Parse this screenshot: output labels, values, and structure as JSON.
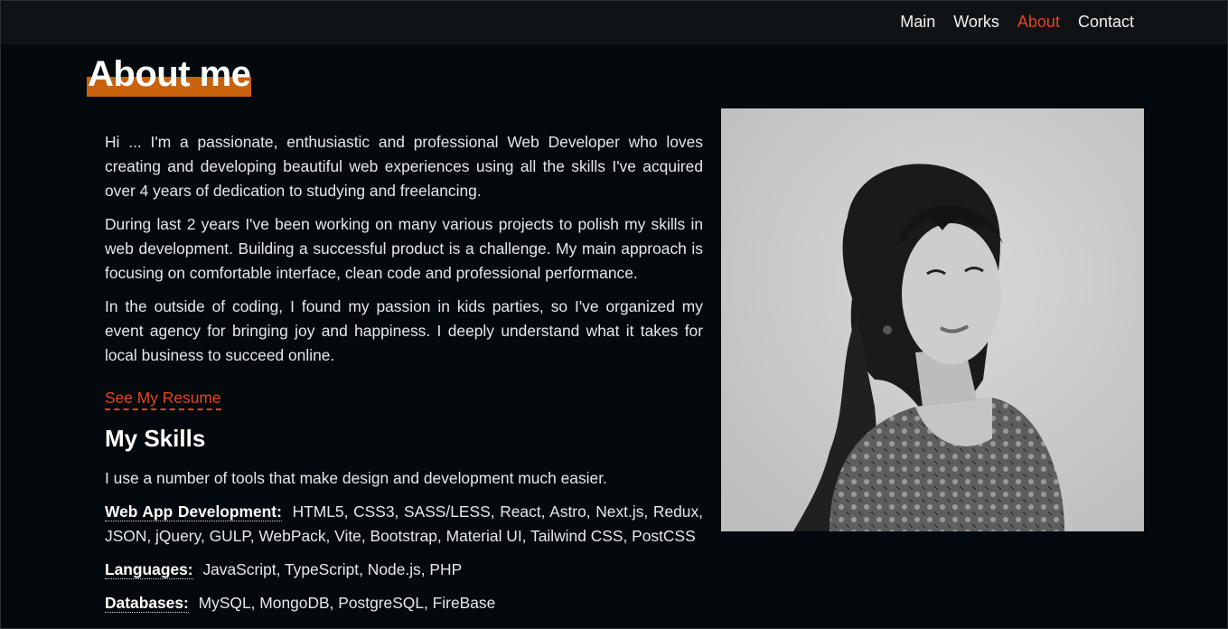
{
  "nav": {
    "items": [
      {
        "label": "Main",
        "active": false
      },
      {
        "label": "Works",
        "active": false
      },
      {
        "label": "About",
        "active": true
      },
      {
        "label": "Contact",
        "active": false
      }
    ]
  },
  "about": {
    "title": "About me",
    "paragraphs": [
      "Hi ... I'm a passionate, enthusiastic and professional Web Developer who loves creating and developing beautiful web experiences using all the skills I've acquired over 4 years of dedication to studying and freelancing.",
      "During last 2 years I've been working on many various projects to polish my skills in web development. Building a successful product is a challenge. My main approach is focusing on comfortable interface, clean code and professional performance.",
      "In the outside of coding, I found my passion in kids parties, so I've organized my event agency for bringing joy and happiness. I deeply understand what it takes for local business to succeed online."
    ],
    "resume_link": "See My Resume"
  },
  "skills": {
    "title": "My Skills",
    "intro": "I use a number of tools that make design and development much easier.",
    "groups": [
      {
        "label": "Web App Development:",
        "items": "HTML5, CSS3, SASS/LESS, React, Astro, Next.js, Redux, JSON, jQuery, GULP, WebPack, Vite, Bootstrap, Material UI, Tailwind CSS, PostCSS"
      },
      {
        "label": "Languages:",
        "items": "JavaScript, TypeScript, Node.js, PHP"
      },
      {
        "label": "Databases:",
        "items": "MySQL, MongoDB, PostgreSQL, FireBase"
      }
    ]
  },
  "colors": {
    "accent": "#e8431e",
    "title_highlight": "#c9620f",
    "background": "#03090d",
    "navbar": "#101316"
  }
}
